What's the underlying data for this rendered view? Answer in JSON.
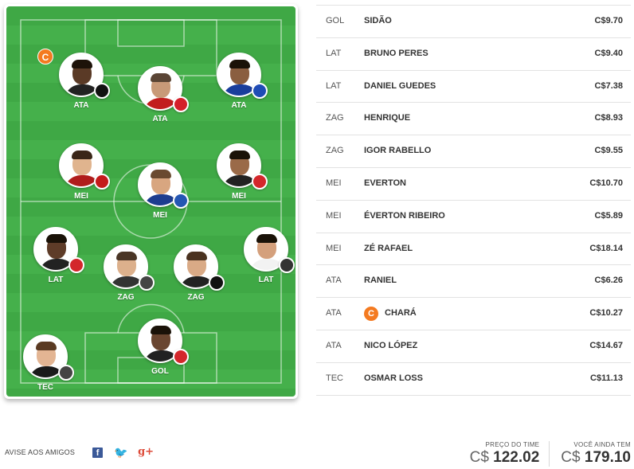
{
  "field": {
    "captain_marker": "C",
    "players": [
      {
        "pos": "ATA",
        "club": "CAM",
        "skin": "#5a3a26",
        "hair": "#1d1209",
        "shirt": "#222222",
        "badge": "#111111"
      },
      {
        "pos": "ATA",
        "club": "INT",
        "skin": "#c89a78",
        "hair": "#5a4535",
        "shirt": "#c21d1d",
        "badge": "#d4202a"
      },
      {
        "pos": "ATA",
        "club": "CRU",
        "skin": "#8a5e40",
        "hair": "#1a1208",
        "shirt": "#1a3e9c",
        "badge": "#1f4cb5"
      },
      {
        "pos": "MEI",
        "club": "FLA",
        "skin": "#e0b48e",
        "hair": "#3a2618",
        "shirt": "#b01c1c",
        "badge": "#c41b1b"
      },
      {
        "pos": "MEI",
        "club": "BAH",
        "skin": "#d8a680",
        "hair": "#6a4a30",
        "shirt": "#1d3d8f",
        "badge": "#2456b3"
      },
      {
        "pos": "MEI",
        "club": "SAO",
        "skin": "#9a6a48",
        "hair": "#1a1208",
        "shirt": "#222222",
        "badge": "#d3272b"
      },
      {
        "pos": "LAT",
        "club": "SAO",
        "skin": "#5e3c28",
        "hair": "#1a1208",
        "shirt": "#222222",
        "badge": "#d3272b"
      },
      {
        "pos": "ZAG",
        "club": "COR",
        "skin": "#dcb08c",
        "hair": "#4a3526",
        "shirt": "#333333",
        "badge": "#444444"
      },
      {
        "pos": "ZAG",
        "club": "BOT",
        "skin": "#d9aa86",
        "hair": "#4a3220",
        "shirt": "#222222",
        "badge": "#111111"
      },
      {
        "pos": "LAT",
        "club": "SAN",
        "skin": "#d4a07c",
        "hair": "#1a1208",
        "shirt": "#f2f2f2",
        "badge": "#333333"
      },
      {
        "pos": "TEC",
        "club": "COR",
        "skin": "#e3b593",
        "hair": "#5a3a22",
        "shirt": "#1a1a1a",
        "badge": "#444444"
      },
      {
        "pos": "GOL",
        "club": "SAO",
        "skin": "#6a4630",
        "hair": "#1a1208",
        "shirt": "#222222",
        "badge": "#d3272b"
      }
    ]
  },
  "roster": [
    {
      "pos": "GOL",
      "name": "SIDÃO",
      "price": "C$9.70",
      "captain": false
    },
    {
      "pos": "LAT",
      "name": "BRUNO PERES",
      "price": "C$9.40",
      "captain": false
    },
    {
      "pos": "LAT",
      "name": "DANIEL GUEDES",
      "price": "C$7.38",
      "captain": false
    },
    {
      "pos": "ZAG",
      "name": "HENRIQUE",
      "price": "C$8.93",
      "captain": false
    },
    {
      "pos": "ZAG",
      "name": "IGOR RABELLO",
      "price": "C$9.55",
      "captain": false
    },
    {
      "pos": "MEI",
      "name": "EVERTON",
      "price": "C$10.70",
      "captain": false
    },
    {
      "pos": "MEI",
      "name": "ÉVERTON RIBEIRO",
      "price": "C$5.89",
      "captain": false
    },
    {
      "pos": "MEI",
      "name": "ZÉ RAFAEL",
      "price": "C$18.14",
      "captain": false
    },
    {
      "pos": "ATA",
      "name": "RANIEL",
      "price": "C$6.26",
      "captain": false
    },
    {
      "pos": "ATA",
      "name": "CHARÁ",
      "price": "C$10.27",
      "captain": true
    },
    {
      "pos": "ATA",
      "name": "NICO LÓPEZ",
      "price": "C$14.67",
      "captain": false
    },
    {
      "pos": "TEC",
      "name": "OSMAR LOSS",
      "price": "C$11.13",
      "captain": false
    }
  ],
  "footer": {
    "share_label": "AVISE AOS AMIGOS",
    "facebook_glyph": "f",
    "twitter_glyph": "🐦",
    "gplus_glyph": "g+",
    "team_price_title": "PREÇO DO TIME",
    "team_price_currency": "C$",
    "team_price_value": "122.02",
    "balance_title": "VOCÊ AINDA TEM",
    "balance_currency": "C$",
    "balance_value": "179.10"
  },
  "colors": {
    "field_light": "#45b04b",
    "field_dark": "#3fa845",
    "captain": "#f47a20"
  }
}
